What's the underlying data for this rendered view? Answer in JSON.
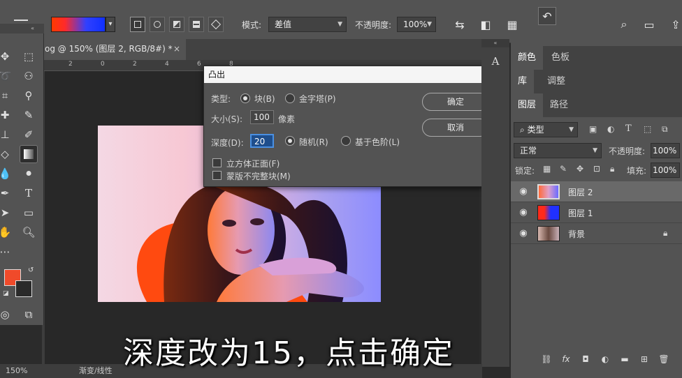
{
  "options_bar": {
    "mode_label": "模式:",
    "mode_value": "差值",
    "opacity_label": "不透明度:",
    "opacity_value": "100%"
  },
  "document": {
    "tab_title": "og @ 150% (图层 2, RGB/8#) *",
    "ruler_ticks": [
      "2",
      "0",
      "2",
      "4",
      "6",
      "8"
    ],
    "status_zoom": "150%",
    "status_text": "渐变/线性"
  },
  "dialog": {
    "title": "凸出",
    "type_label": "类型:",
    "type_block": "块(B)",
    "type_pyramid": "金字塔(P)",
    "size_label": "大小(S):",
    "size_value": "100",
    "size_unit": "像素",
    "depth_label": "深度(D):",
    "depth_value": "20",
    "depth_random": "随机(R)",
    "depth_level": "基于色阶(L)",
    "solid_front": "立方体正面(F)",
    "mask_incomplete": "蒙版不完整块(M)",
    "ok": "确定",
    "cancel": "取消"
  },
  "panels": {
    "tabs_row1": [
      "颜色",
      "色板"
    ],
    "tabs_row2": [
      "库",
      "调整"
    ],
    "tabs_row3": [
      "图层",
      "路径"
    ],
    "filter_kind": "类型",
    "blend_mode": "正常",
    "opacity_label": "不透明度:",
    "opacity_value": "100%",
    "lock_label": "锁定:",
    "fill_label": "填充:",
    "fill_value": "100%",
    "layers": [
      {
        "name": "图层 2",
        "selected": true
      },
      {
        "name": "图层 1",
        "selected": false
      },
      {
        "name": "背景",
        "selected": false,
        "locked": true
      }
    ],
    "footer_fx": "fx"
  },
  "subtitle": "深度改为15，点击确定",
  "colors": {
    "foreground": "#f04a2a",
    "background": "#2a2a2a",
    "accent": "#4a90e2"
  }
}
